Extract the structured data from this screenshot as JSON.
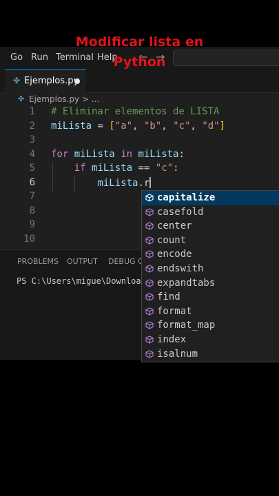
{
  "caption": {
    "line1": "Modificar lista en",
    "line2": "Python"
  },
  "menu": {
    "go": "Go",
    "run": "Run",
    "terminal": "Terminal",
    "help": "Help"
  },
  "tab": {
    "filename": "Ejemplos.py"
  },
  "breadcrumb": {
    "file": "Ejemplos.py",
    "sep": ">",
    "more": "..."
  },
  "editor": {
    "line_numbers": [
      "1",
      "2",
      "3",
      "4",
      "5",
      "6",
      "7",
      "8",
      "9",
      "10"
    ],
    "active_line": 6
  },
  "panel": {
    "tabs": [
      "PROBLEMS",
      "OUTPUT",
      "DEBUG CONSOLE"
    ],
    "terminal_text": "PS C:\\Users\\migue\\Downloads\\Python"
  },
  "suggestions": [
    "capitalize",
    "casefold",
    "center",
    "count",
    "encode",
    "endswith",
    "expandtabs",
    "find",
    "format",
    "format_map",
    "index",
    "isalnum"
  ],
  "colors": {
    "caption": "#e0141b",
    "keyword": "#c586c0",
    "string": "#ce9178",
    "variable": "#9cdcfe",
    "comment": "#6a9955",
    "selection": "#04395e"
  }
}
